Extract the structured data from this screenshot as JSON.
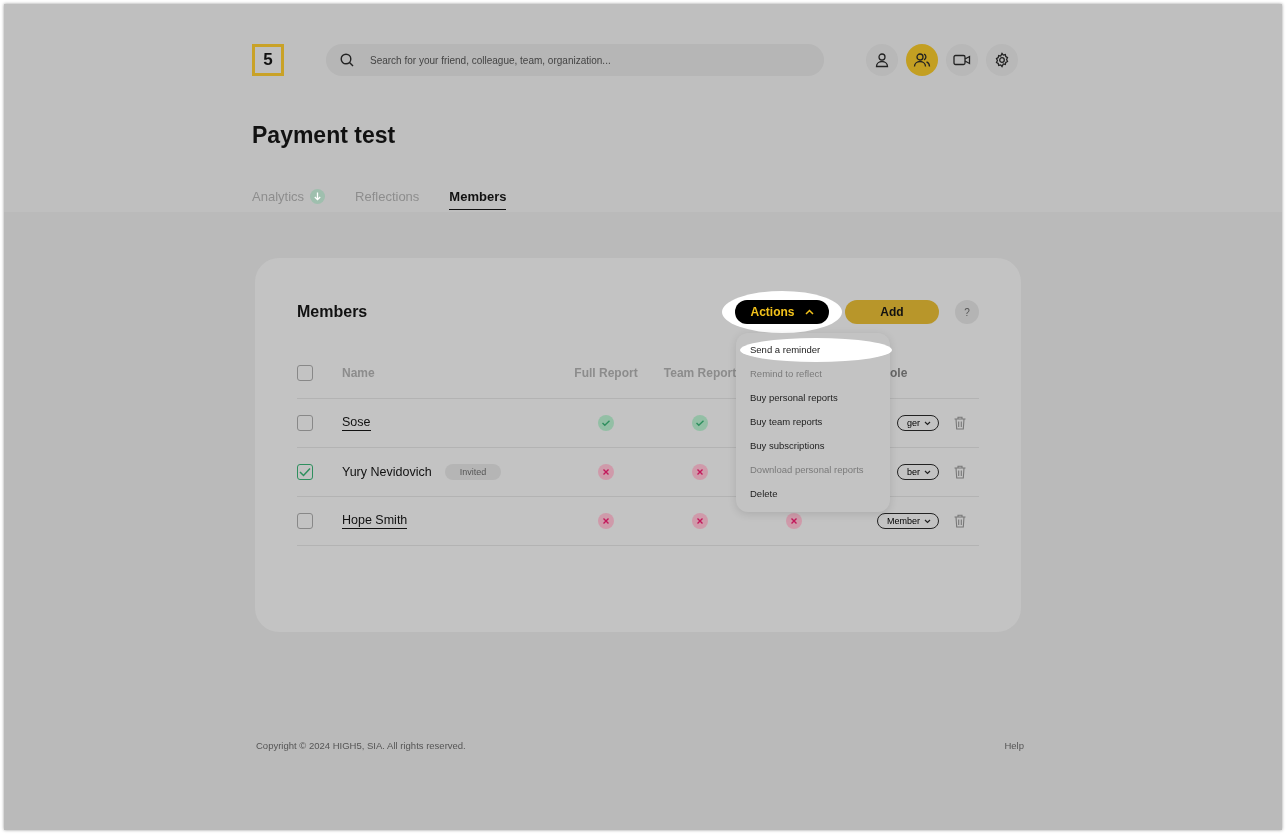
{
  "logo": {
    "text": "5"
  },
  "search": {
    "placeholder": "Search for your friend, colleague, team, organization..."
  },
  "nav_icons": [
    {
      "kind": "person",
      "selected": false
    },
    {
      "kind": "people",
      "selected": true
    },
    {
      "kind": "video",
      "selected": false
    },
    {
      "kind": "settings",
      "selected": false
    }
  ],
  "page_title": "Payment test",
  "tabs": [
    {
      "label": "Analytics",
      "selected": false,
      "badge": true
    },
    {
      "label": "Reflections",
      "selected": false,
      "badge": false
    },
    {
      "label": "Members",
      "selected": true,
      "badge": false
    }
  ],
  "members": {
    "title": "Members",
    "actions_button": "Actions",
    "add_button": "Add",
    "help": "?",
    "header_checked": false,
    "columns": [
      "Name",
      "Full Report",
      "Team Report",
      "ole"
    ],
    "rows": [
      {
        "name": "Sose",
        "underlined": true,
        "checked": false,
        "full_report_ok": true,
        "team_report_ok": true,
        "role": "ger"
      },
      {
        "name": "Yury Nevidovich",
        "underlined": false,
        "checked": true,
        "tag": "Invited",
        "full_report_ok": false,
        "team_report_ok": false,
        "role": "ber"
      },
      {
        "name": "Hope Smith",
        "underlined": true,
        "checked": false,
        "full_report_ok": false,
        "team_report_ok": false,
        "column_4_ok": false,
        "role": "Member"
      }
    ],
    "menu": [
      {
        "label": "Send a reminder",
        "disabled": false,
        "highlighted": true
      },
      {
        "label": "Remind to reflect",
        "disabled": true,
        "highlighted": false
      },
      {
        "label": "Buy personal reports",
        "disabled": false,
        "highlighted": false
      },
      {
        "label": "Buy team reports",
        "disabled": false,
        "highlighted": false
      },
      {
        "label": "Buy subscriptions",
        "disabled": false,
        "highlighted": false
      },
      {
        "label": "Download personal reports",
        "disabled": true,
        "highlighted": false
      },
      {
        "label": "Delete",
        "disabled": false,
        "highlighted": false
      }
    ]
  },
  "footer": {
    "copyright": "Copyright © 2024 HIGH5, SIA. All rights reserved.",
    "help": "Help"
  }
}
